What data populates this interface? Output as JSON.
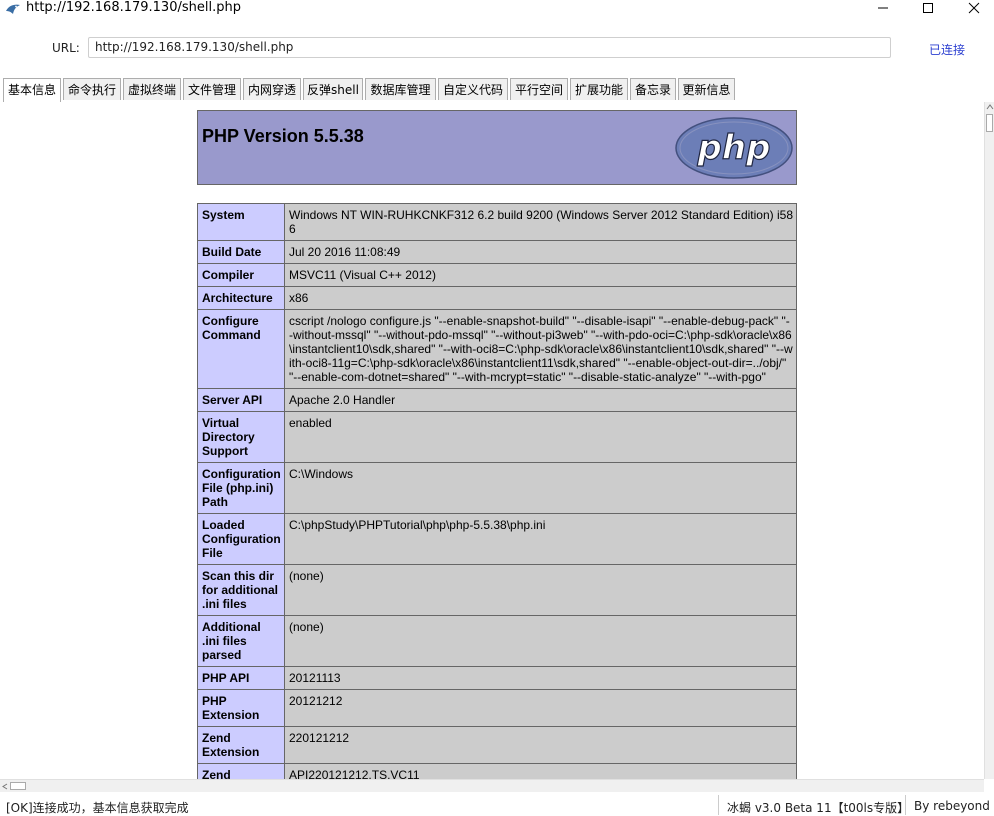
{
  "window": {
    "title": "http://192.168.179.130/shell.php"
  },
  "url_bar": {
    "label": "URL:",
    "value": "http://192.168.179.130/shell.php",
    "status": "已连接"
  },
  "tabs": [
    {
      "label": "基本信息",
      "active": true
    },
    {
      "label": "命令执行"
    },
    {
      "label": "虚拟终端"
    },
    {
      "label": "文件管理"
    },
    {
      "label": "内网穿透"
    },
    {
      "label": "反弹shell"
    },
    {
      "label": "数据库管理"
    },
    {
      "label": "自定义代码"
    },
    {
      "label": "平行空间"
    },
    {
      "label": "扩展功能"
    },
    {
      "label": "备忘录"
    },
    {
      "label": "更新信息"
    }
  ],
  "phpinfo": {
    "version_title": "PHP Version 5.5.38",
    "logo_text": "php",
    "rows": [
      {
        "key": "System",
        "value": "Windows NT WIN-RUHKCNKF312 6.2 build 9200 (Windows Server 2012 Standard Edition) i586"
      },
      {
        "key": "Build Date",
        "value": "Jul 20 2016 11:08:49"
      },
      {
        "key": "Compiler",
        "value": "MSVC11 (Visual C++ 2012)"
      },
      {
        "key": "Architecture",
        "value": "x86"
      },
      {
        "key": "Configure Command",
        "value": "cscript /nologo configure.js \"--enable-snapshot-build\" \"--disable-isapi\" \"--enable-debug-pack\" \"--without-mssql\" \"--without-pdo-mssql\" \"--without-pi3web\" \"--with-pdo-oci=C:\\php-sdk\\oracle\\x86\\instantclient10\\sdk,shared\" \"--with-oci8=C:\\php-sdk\\oracle\\x86\\instantclient10\\sdk,shared\" \"--with-oci8-11g=C:\\php-sdk\\oracle\\x86\\instantclient11\\sdk,shared\" \"--enable-object-out-dir=../obj/\" \"--enable-com-dotnet=shared\" \"--with-mcrypt=static\" \"--disable-static-analyze\" \"--with-pgo\""
      },
      {
        "key": "Server API",
        "value": "Apache 2.0 Handler"
      },
      {
        "key": "Virtual Directory Support",
        "value": "enabled"
      },
      {
        "key": "Configuration File (php.ini) Path",
        "value": "C:\\Windows"
      },
      {
        "key": "Loaded Configuration File",
        "value": "C:\\phpStudy\\PHPTutorial\\php\\php-5.5.38\\php.ini"
      },
      {
        "key": "Scan this dir for additional .ini files",
        "value": "(none)"
      },
      {
        "key": "Additional .ini files parsed",
        "value": "(none)"
      },
      {
        "key": "PHP API",
        "value": "20121113"
      },
      {
        "key": "PHP Extension",
        "value": "20121212"
      },
      {
        "key": "Zend Extension",
        "value": "220121212"
      },
      {
        "key": "Zend Extension Build",
        "value": "API220121212,TS,VC11"
      }
    ]
  },
  "statusbar": {
    "left": "[OK]连接成功，基本信息获取完成",
    "middle": "冰蝎 v3.0 Beta 11【t00ls专版】",
    "right": "By rebeyond"
  }
}
